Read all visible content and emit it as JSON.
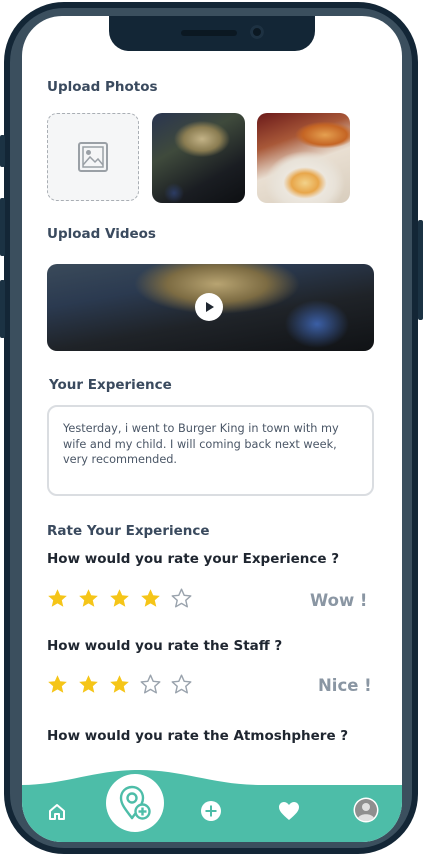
{
  "upload_photos": {
    "label": "Upload Photos"
  },
  "upload_videos": {
    "label": "Upload Videos"
  },
  "experience": {
    "label": "Your Experience",
    "text": "Yesterday, i went to Burger King in town with my wife and my child. I will coming back next week, very recommended."
  },
  "rating": {
    "label": "Rate Your Experience",
    "questions": [
      {
        "text": "How would you rate your Experience ?",
        "stars": 4,
        "max": 5,
        "verdict": "Wow !"
      },
      {
        "text": "How would you rate the Staff ?",
        "stars": 3,
        "max": 5,
        "verdict": "Nice !"
      },
      {
        "text": "How would you rate the Atmoshphere ?"
      }
    ]
  },
  "colors": {
    "accent": "#4dbda8",
    "star_filled": "#f5c518",
    "star_empty": "#9aa3ad"
  },
  "tabbar": {
    "icons": [
      "home-icon",
      "map-pin-add-icon",
      "plus-circle-icon",
      "heart-icon",
      "profile-avatar"
    ]
  }
}
